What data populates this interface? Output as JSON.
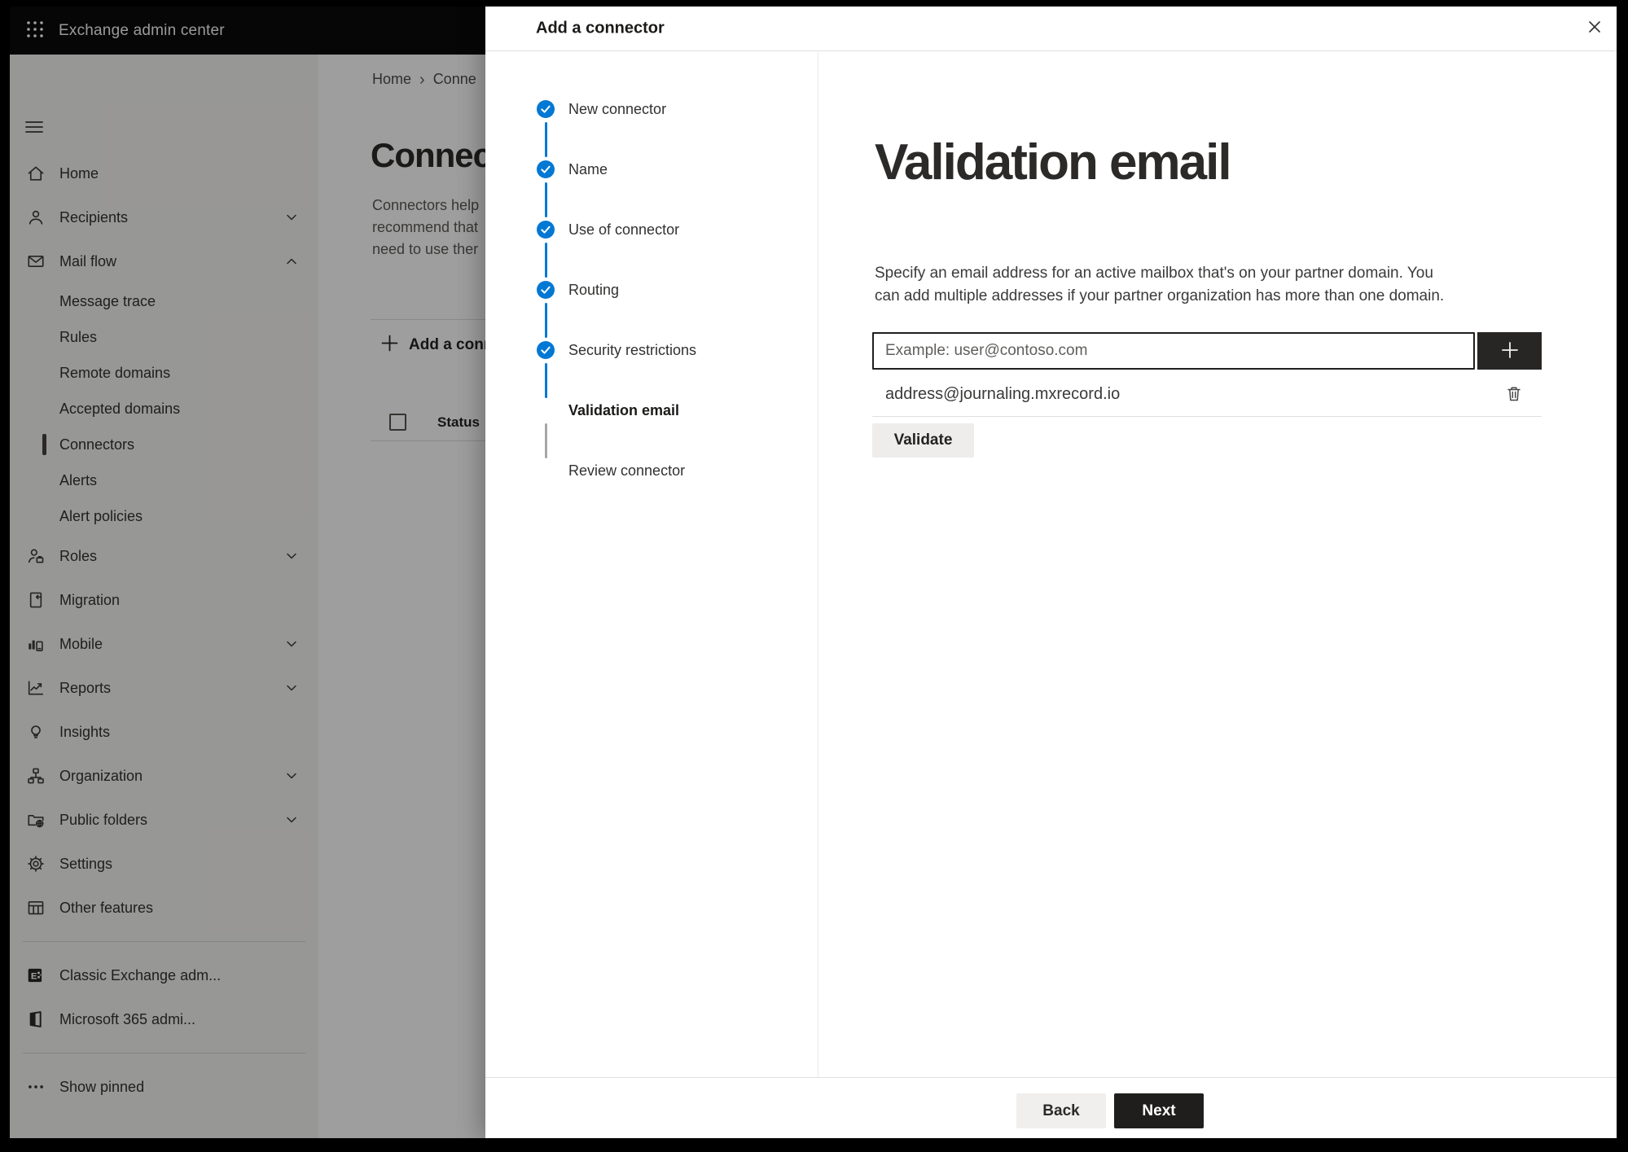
{
  "header": {
    "app_title": "Exchange admin center",
    "waffle_icon": "waffle-icon",
    "menu_icon": "hamburger-icon"
  },
  "sidebar": {
    "items": [
      {
        "label": "Home",
        "icon": "home-icon",
        "type": "main"
      },
      {
        "label": "Recipients",
        "icon": "person-icon",
        "type": "main",
        "chevron": "chevron-down-icon"
      },
      {
        "label": "Mail flow",
        "icon": "mail-icon",
        "type": "main",
        "chevron": "chevron-up-icon"
      },
      {
        "label": "Message trace",
        "type": "sub"
      },
      {
        "label": "Rules",
        "type": "sub"
      },
      {
        "label": "Remote domains",
        "type": "sub"
      },
      {
        "label": "Accepted domains",
        "type": "sub"
      },
      {
        "label": "Connectors",
        "type": "sub",
        "selected": true
      },
      {
        "label": "Alerts",
        "type": "sub"
      },
      {
        "label": "Alert policies",
        "type": "sub"
      },
      {
        "label": "Roles",
        "icon": "roles-icon",
        "type": "main",
        "chevron": "chevron-down-icon"
      },
      {
        "label": "Migration",
        "icon": "migration-icon",
        "type": "main"
      },
      {
        "label": "Mobile",
        "icon": "mobile-icon",
        "type": "main",
        "chevron": "chevron-down-icon"
      },
      {
        "label": "Reports",
        "icon": "reports-icon",
        "type": "main",
        "chevron": "chevron-down-icon"
      },
      {
        "label": "Insights",
        "icon": "insights-icon",
        "type": "main"
      },
      {
        "label": "Organization",
        "icon": "organization-icon",
        "type": "main",
        "chevron": "chevron-down-icon"
      },
      {
        "label": "Public folders",
        "icon": "public-folders-icon",
        "type": "main",
        "chevron": "chevron-down-icon"
      },
      {
        "label": "Settings",
        "icon": "settings-icon",
        "type": "main"
      },
      {
        "label": "Other features",
        "icon": "other-features-icon",
        "type": "main"
      },
      {
        "divider": true
      },
      {
        "label": "Classic Exchange adm...",
        "icon": "classic-exchange-icon",
        "type": "main"
      },
      {
        "label": "Microsoft 365 admi...",
        "icon": "microsoft-365-icon",
        "type": "main"
      },
      {
        "divider": true
      },
      {
        "label": "Show pinned",
        "icon": "ellipsis-icon",
        "type": "main"
      }
    ]
  },
  "background_page": {
    "breadcrumb": {
      "home": "Home",
      "separator": "›",
      "current": "Conne"
    },
    "title": "Connec",
    "description_lines": {
      "line1": "Connectors help",
      "line2": "recommend that",
      "line3": "need to use ther"
    },
    "add_button_label": "Add a conn",
    "status_column_label": "Status"
  },
  "dialog": {
    "title": "Add a connector",
    "close_icon": "close-icon",
    "steps": [
      {
        "label": "New connector",
        "state": "completed",
        "circle_icon": "check-icon"
      },
      {
        "label": "Name",
        "state": "completed",
        "circle_icon": "check-icon"
      },
      {
        "label": "Use of connector",
        "state": "completed",
        "circle_icon": "check-icon"
      },
      {
        "label": "Routing",
        "state": "completed",
        "circle_icon": "check-icon"
      },
      {
        "label": "Security restrictions",
        "state": "completed",
        "circle_icon": "check-icon"
      },
      {
        "label": "Validation email",
        "state": "current"
      },
      {
        "label": "Review connector",
        "state": "upcoming"
      }
    ],
    "content": {
      "heading": "Validation email",
      "description": "Specify an email address for an active mailbox that's on your partner domain. You can add multiple addresses if your partner organization has more than one domain.",
      "email_input_placeholder": "Example: user@contoso.com",
      "added_addresses": [
        "address@journaling.mxrecord.io"
      ],
      "validate_button_label": "Validate"
    },
    "footer": {
      "back_button_label": "Back",
      "next_button_label": "Next"
    }
  },
  "colors": {
    "accent": "#0078d4",
    "topbar_bg": "#0a0a0a",
    "primary_button_bg": "#1f1e1d",
    "step_upcoming_ring": "#979593"
  }
}
